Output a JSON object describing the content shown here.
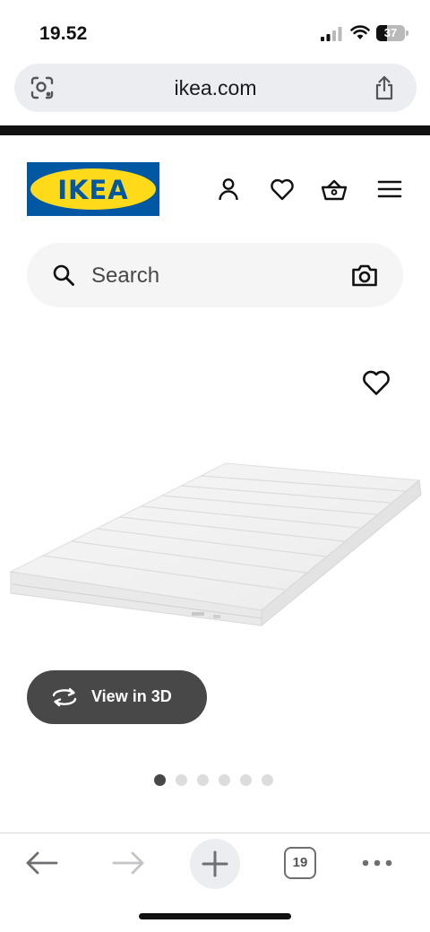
{
  "status_bar": {
    "time": "19.52",
    "battery_level": "37",
    "icons": [
      "signal-icon",
      "wifi-icon",
      "battery-icon"
    ]
  },
  "browser": {
    "url": "ikea.com",
    "open_tabs": "19",
    "icons": [
      "lens-icon",
      "share-icon",
      "back-icon",
      "forward-icon",
      "plus-icon",
      "more-icon"
    ]
  },
  "header": {
    "logo_text": "IKEA",
    "icons": [
      "user-icon",
      "heart-icon",
      "shopping-bag-icon",
      "menu-icon"
    ]
  },
  "search": {
    "placeholder": "Search",
    "icons": [
      "search-icon",
      "camera-icon"
    ]
  },
  "product_gallery": {
    "image": "mattress-topper",
    "view_3d_label": "View in 3D",
    "image_count": 6,
    "active_index": 0
  },
  "colors": {
    "ikea_blue": "#0058a3",
    "ikea_yellow": "#ffda1a",
    "button_dark": "#484848",
    "url_bar_bg": "#ebedf0"
  }
}
